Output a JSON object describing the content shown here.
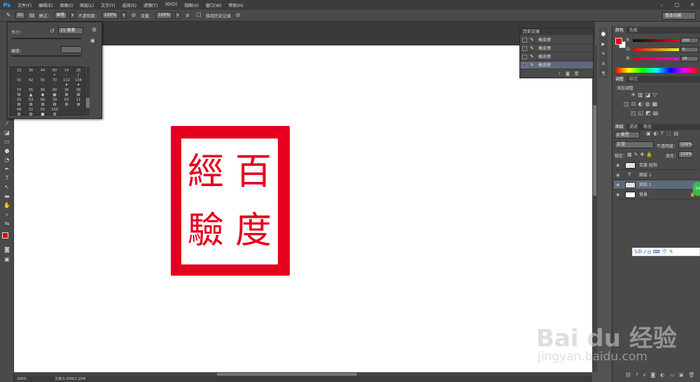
{
  "app": {
    "logo": "Ps",
    "menus": [
      "文件(F)",
      "编辑(E)",
      "图像(I)",
      "图层(L)",
      "文字(Y)",
      "选择(S)",
      "滤镜(T)",
      "3D(D)",
      "视图(V)",
      "窗口(W)",
      "帮助(H)"
    ],
    "window_controls": [
      "–",
      "□",
      "✕"
    ]
  },
  "options": {
    "brush_size": "25",
    "mode_label": "模式：",
    "mode_value": "画笔",
    "opacity_label": "不透明度：",
    "opacity_value": "100%",
    "flow_label": "流量：",
    "flow_value": "100%",
    "erase_history": "抹到历史记录",
    "workspace": "基本功能"
  },
  "brush_popup": {
    "size_label": "大小：",
    "size_value": "25 像素",
    "hardness_label": "硬度：",
    "preset_sizes": [
      "23",
      "36",
      "44",
      "60",
      "14",
      "26",
      "33",
      "42",
      "55",
      "70",
      "112",
      "134",
      "74",
      "95",
      "95",
      "90",
      "36",
      "36",
      "33",
      "63",
      "66",
      "39",
      "63",
      "11",
      "48",
      "32",
      "55",
      "100"
    ]
  },
  "history": {
    "title": "历史记录",
    "items": [
      "橡皮擦",
      "橡皮擦",
      "橡皮擦",
      "橡皮擦"
    ]
  },
  "seal": {
    "chars": [
      "百",
      "度",
      "經",
      "驗"
    ]
  },
  "color": {
    "tabs": [
      "颜色",
      "色板"
    ],
    "channels": [
      {
        "name": "R",
        "value": "230"
      },
      {
        "name": "G",
        "value": "0"
      },
      {
        "name": "B",
        "value": "18"
      }
    ],
    "fg": "#e60012",
    "bg": "#ffffff"
  },
  "adjustments": {
    "tabs": [
      "调整",
      "样式"
    ],
    "heading": "添加调整"
  },
  "layers": {
    "tabs": [
      "图层",
      "通道",
      "路径"
    ],
    "kind_label": "ρ 类型",
    "blend": "正常",
    "opacity_label": "不透明度：",
    "opacity": "100%",
    "lock_label": "锁定：",
    "fill_label": "填充：",
    "fill": "100%",
    "items": [
      {
        "name": "百度 经验",
        "type": "raster"
      },
      {
        "name": "图层 1",
        "type": "text"
      },
      {
        "name": "矩形 1",
        "type": "raster",
        "selected": true
      },
      {
        "name": "背景",
        "type": "bg"
      }
    ]
  },
  "status": {
    "zoom": "200%",
    "doc": "文档:5.93M/1.25M"
  },
  "ime": {
    "label": "S中ノ◎ ⌨ 👕 ✎"
  },
  "float": {
    "label": "54"
  },
  "watermark": {
    "brand": "Bai du 经验",
    "url": "jingyan.baidu.com"
  }
}
